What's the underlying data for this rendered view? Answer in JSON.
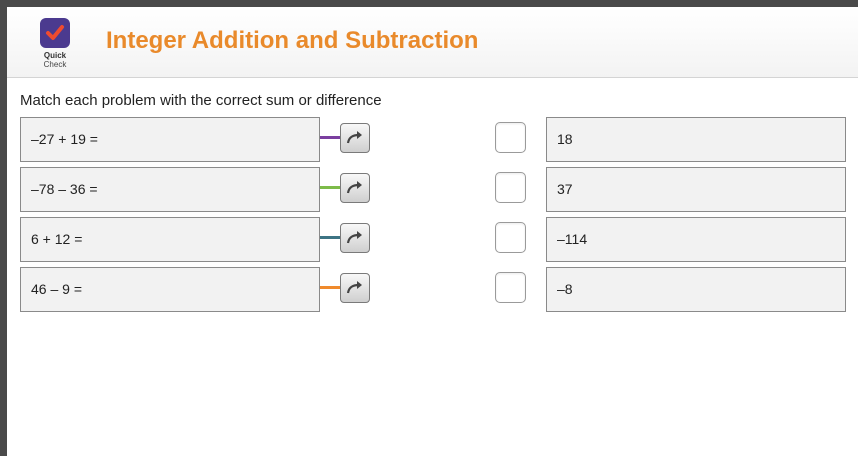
{
  "logo": {
    "line1": "Quick",
    "line2": "Check",
    "icon": "checkmark-icon",
    "color": "#4b3a8f",
    "check_color": "#ef4b2f"
  },
  "title": "Integer Addition and Subtraction",
  "instructions": "Match each problem with the correct sum or difference",
  "problems": [
    {
      "text": "–27 + 19 =",
      "color": "#7b3fa0"
    },
    {
      "text": "–78 – 36 =",
      "color": "#7dbb49"
    },
    {
      "text": "6 + 12 =",
      "color": "#3d7484"
    },
    {
      "text": "46 – 9 =",
      "color": "#f08a2c"
    }
  ],
  "answers": [
    {
      "text": "18"
    },
    {
      "text": "37"
    },
    {
      "text": "–114"
    },
    {
      "text": "–8"
    }
  ],
  "arrow_icon": "curved-arrow-icon"
}
